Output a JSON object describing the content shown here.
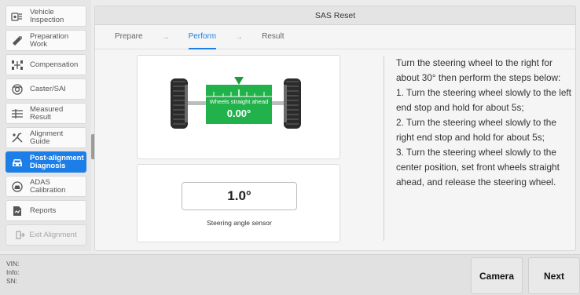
{
  "sidebar": {
    "items": [
      {
        "label": "Vehicle\nInspection",
        "icon": "vehicle-inspection-icon"
      },
      {
        "label": "Preparation\nWork",
        "icon": "preparation-icon"
      },
      {
        "label": "Compensation",
        "icon": "compensation-icon"
      },
      {
        "label": "Caster/SAI",
        "icon": "caster-icon"
      },
      {
        "label": "Measured\nResult",
        "icon": "measured-result-icon"
      },
      {
        "label": "Alignment\nGuide",
        "icon": "alignment-guide-icon"
      },
      {
        "label": "Post-alignment\nDiagnosis",
        "icon": "car-icon",
        "active": true
      },
      {
        "label": "ADAS\nCalibration",
        "icon": "adas-icon"
      },
      {
        "label": "Reports",
        "icon": "reports-icon"
      }
    ],
    "exit_label": "Exit Alignment"
  },
  "header": {
    "title": "SAS Reset"
  },
  "steps": {
    "prepare": "Prepare",
    "perform": "Perform",
    "result": "Result",
    "arrow": "→"
  },
  "gauge": {
    "label": "Wheels straight ahead",
    "value": "0.00°"
  },
  "sensor": {
    "value": "1.0°",
    "label": "Steering angle sensor"
  },
  "instructions": [
    "Turn the steering wheel to the right for about 30° then perform the steps below:",
    "1. Turn the steering wheel slowly to the left end stop and hold for about 5s;",
    "2. Turn the steering wheel slowly to the right end stop and hold for about 5s;",
    "3. Turn the steering wheel slowly to the center position, set front wheels straight ahead, and release the steering wheel."
  ],
  "footer": {
    "vin_label": "VIN:",
    "info_label": "Info:",
    "sn_label": "SN:",
    "camera_label": "Camera",
    "next_label": "Next"
  },
  "colors": {
    "accent": "#1c7ee6",
    "gauge_green": "#22b24c"
  }
}
